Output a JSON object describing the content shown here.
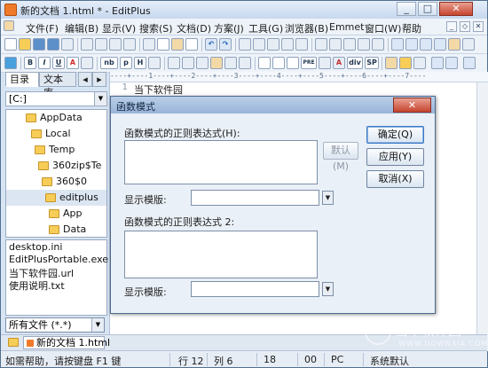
{
  "window": {
    "title": "新的文档 1.html * - EditPlus",
    "min_label": "_",
    "max_label": "□",
    "close_label": "✕"
  },
  "menu": [
    "文件(F)",
    "编辑(B)",
    "显示(V)",
    "搜索(S)",
    "文档(D)",
    "方案(J)",
    "工具(G)",
    "浏览器(B)",
    "Emmet",
    "窗口(W)",
    "帮助"
  ],
  "mdi_controls": [
    "_",
    "◇",
    "✕"
  ],
  "toolbar2_text": [
    "B",
    "I",
    "U",
    "A",
    "nb",
    "p",
    "H",
    "PRE",
    "div",
    "SP"
  ],
  "sidebar": {
    "tabs": [
      "目录",
      "文本库"
    ],
    "drive": "[C:]",
    "folders": [
      "AppData",
      "Local",
      "Temp",
      "360zip$Te",
      "360$0",
      "editplus",
      "App",
      "Data"
    ],
    "files": [
      "desktop.ini",
      "EditPlusPortable.exe",
      "当下软件园.url",
      "使用说明.txt"
    ],
    "filter": "所有文件 (*.*)"
  },
  "editor": {
    "line_number": "1",
    "line1": "当下软件园",
    "ruler": "----+----1----+----2----+----3----+----4----+----5----+----6----+----7----"
  },
  "dialog": {
    "title": "函数模式",
    "close_label": "✕",
    "regex1_label": "函数模式的正则表达式(H):",
    "default_button": "默认(M)",
    "template1_label": "显示模版:",
    "regex2_label": "函数模式的正则表达式 2:",
    "template2_label": "显示模版:",
    "ok_button": "确定(Q)",
    "apply_button": "应用(Y)",
    "cancel_button": "取消(X)",
    "dropdown_glyph": "▼"
  },
  "doc_tab": "新的文档 1.html",
  "status": {
    "help": "如需帮助，请按键盘 F1 键",
    "line": "行 12",
    "col": "列 6",
    "n1": "18",
    "n2": "00",
    "mode": "PC",
    "encoding": "系统默认"
  },
  "watermark": {
    "text": "当下软件园",
    "url": "WWW.DOWNXIA.COM"
  },
  "colors": {
    "title_bar": "#c7d8ee",
    "folder": "#f7cd57",
    "close_button": "#c5442f",
    "primary_focus": "#3b78c4"
  }
}
